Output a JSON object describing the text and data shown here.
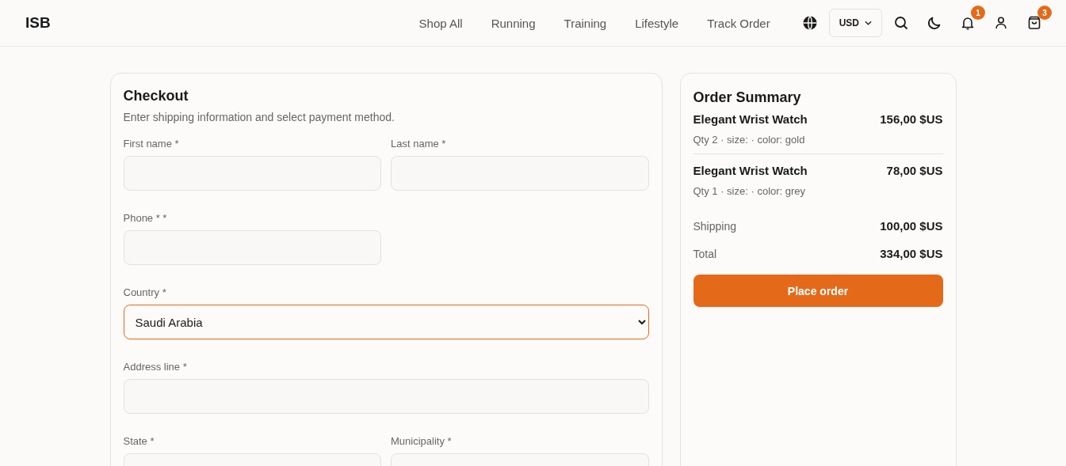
{
  "header": {
    "logo": "ISB",
    "nav": [
      "Shop All",
      "Running",
      "Training",
      "Lifestyle",
      "Track Order"
    ],
    "currency": "USD",
    "notifications_badge": "1",
    "cart_badge": "3"
  },
  "checkout": {
    "title": "Checkout",
    "subtitle": "Enter shipping information and select payment method.",
    "rows": [
      {
        "kind": "pair",
        "fields": [
          {
            "label": "First name *",
            "kind": "input",
            "focused": false
          },
          {
            "label": "Last name *",
            "kind": "input",
            "focused": false
          }
        ]
      },
      {
        "kind": "half",
        "fields": [
          {
            "label": "Phone * *",
            "kind": "input",
            "focused": false
          }
        ]
      },
      {
        "kind": "full",
        "fields": [
          {
            "label": "Country *",
            "kind": "select",
            "value": "Saudi Arabia",
            "focused": true
          }
        ]
      },
      {
        "kind": "full",
        "fields": [
          {
            "label": "Address line *",
            "kind": "input",
            "focused": false
          }
        ]
      },
      {
        "kind": "pair",
        "fields": [
          {
            "label": "State *",
            "kind": "input",
            "focused": false
          },
          {
            "label": "Municipality *",
            "kind": "input",
            "focused": false
          }
        ]
      }
    ]
  },
  "summary": {
    "title": "Order Summary",
    "items": [
      {
        "name": "Elegant Wrist Watch",
        "price": "156,00 $US",
        "details": "Qty 2 · size: · color: gold"
      },
      {
        "name": "Elegant Wrist Watch",
        "price": "78,00 $US",
        "details": "Qty 1 · size: · color: grey"
      }
    ],
    "totals": [
      {
        "label": "Shipping",
        "value": "100,00 $US"
      },
      {
        "label": "Total",
        "value": "334,00 $US"
      }
    ],
    "button": "Place order"
  }
}
